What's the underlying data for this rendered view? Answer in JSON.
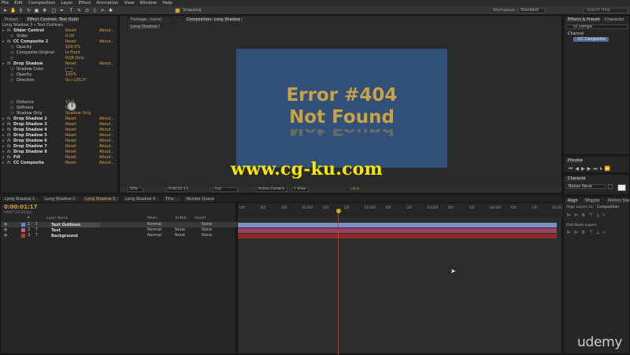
{
  "menubar": [
    "File",
    "Edit",
    "Composition",
    "Layer",
    "Effect",
    "Animation",
    "View",
    "Window",
    "Help"
  ],
  "workspace": {
    "label": "Workspace:",
    "value": "Standard",
    "search_placeholder": "Search Help"
  },
  "toolbar": {
    "snapping_label": "Snapping"
  },
  "project_tab": "Project",
  "effect_controls": {
    "tab": "Effect Controls: Text Outlines",
    "breadcrumb": "Long Shadow 3 • Text Outlines",
    "rows": [
      {
        "name": "Slider Control",
        "bold": true,
        "reset": "Reset",
        "about": "About..."
      },
      {
        "name": "Slider",
        "val": "0.00",
        "sub": true
      },
      {
        "name": "CC Composite 2",
        "bold": true,
        "reset": "Reset",
        "about": "About..."
      },
      {
        "name": "Opacity",
        "val": "100.0%",
        "sub": true
      },
      {
        "name": "Composite Original",
        "val": "In Front",
        "sub": true
      },
      {
        "name": "",
        "val": "RGB Only",
        "sub": true
      },
      {
        "name": "Drop Shadow",
        "bold": true,
        "reset": "Reset",
        "about": "About..."
      },
      {
        "name": "Shadow Color",
        "val": "",
        "sub": true
      },
      {
        "name": "Opacity",
        "val": "100%",
        "sub": true
      },
      {
        "name": "Direction",
        "val": "0x+135.0°",
        "sub": true
      }
    ],
    "rows2": [
      {
        "name": "Distance",
        "val": "11.0",
        "sub": true
      },
      {
        "name": "Softness",
        "val": "0.0",
        "sub": true
      },
      {
        "name": "Shadow Only",
        "val": "Shadow Only",
        "sub": true
      },
      {
        "name": "Drop Shadow 2",
        "bold": true,
        "reset": "Reset",
        "about": "About..."
      },
      {
        "name": "Drop Shadow 3",
        "bold": true,
        "reset": "Reset",
        "about": "About..."
      },
      {
        "name": "Drop Shadow 4",
        "bold": true,
        "reset": "Reset",
        "about": "About..."
      },
      {
        "name": "Drop Shadow 5",
        "bold": true,
        "reset": "Reset",
        "about": "About..."
      },
      {
        "name": "Drop Shadow 6",
        "bold": true,
        "reset": "Reset",
        "about": "About..."
      },
      {
        "name": "Drop Shadow 7",
        "bold": true,
        "reset": "Reset",
        "about": "About..."
      },
      {
        "name": "Drop Shadow 8",
        "bold": true,
        "reset": "Reset",
        "about": "About..."
      },
      {
        "name": "Fill",
        "bold": true,
        "reset": "Reset",
        "about": "About..."
      },
      {
        "name": "CC Composite",
        "bold": true,
        "reset": "Reset",
        "about": "About..."
      }
    ]
  },
  "viewer": {
    "tabs": [
      "Footage: (none)",
      "Composition: Long Shadow 3"
    ],
    "sub_tab": "Long Shadow 3",
    "text_line1": "Error #404",
    "text_line2": "Not Found",
    "zoom": "50%",
    "timecode": "0:00:01:17",
    "resolution": "Full",
    "camera": "Active Camera",
    "views": "1 View",
    "offset": "+0.0"
  },
  "watermark": "www.cg-ku.com",
  "brand": "udemy",
  "effects_presets": {
    "tab": "Effects & Presets",
    "tab2": "Character",
    "search_value": "cc compo",
    "category": "Channel",
    "item": "CC Composite"
  },
  "preview": {
    "tab": "Preview"
  },
  "character": {
    "tab": "Character",
    "font": "Bebas Neue"
  },
  "align": {
    "tabs": [
      "Align",
      "Wiggler",
      "Motion Sketch"
    ],
    "align_layers_label": "Align Layers to:",
    "align_layers_value": "Composition",
    "distribute_label": "Distribute Layers:"
  },
  "timeline": {
    "tabs": [
      "Long Shadow 1",
      "Long Shadow 2",
      "Long Shadow 3",
      "Long Shadow 4",
      "Title",
      "Render Queue"
    ],
    "timecode": "0:00:01:17",
    "frames": "00047 (25.00 fps)",
    "headers": {
      "num": "#",
      "layer": "Layer Name",
      "mode": "Mode",
      "trk": "TrkMat",
      "parent": "Parent"
    },
    "ruler": [
      "00f",
      "05f",
      "10f",
      "01:00f",
      "05f",
      "10f",
      "02:00f",
      "05f",
      "10f",
      "03:00f",
      "05f",
      "10f",
      "04:00f",
      "05f",
      "10f",
      "05:00"
    ],
    "layers": [
      {
        "num": "1",
        "name": "Text Outlines",
        "mode": "Normal",
        "trk": "",
        "parent": "None",
        "color": "#5a8fd8"
      },
      {
        "num": "2",
        "name": "Text",
        "mode": "Normal",
        "trk": "None",
        "parent": "None",
        "color": "#d65a7a"
      },
      {
        "num": "3",
        "name": "Background",
        "mode": "Normal",
        "trk": "None",
        "parent": "None",
        "color": "#c0392b"
      }
    ]
  },
  "colors": {
    "accent": "#d8a138",
    "comp_bg": "#32517a",
    "error_text": "#caa143",
    "watermark": "#f5e800"
  }
}
